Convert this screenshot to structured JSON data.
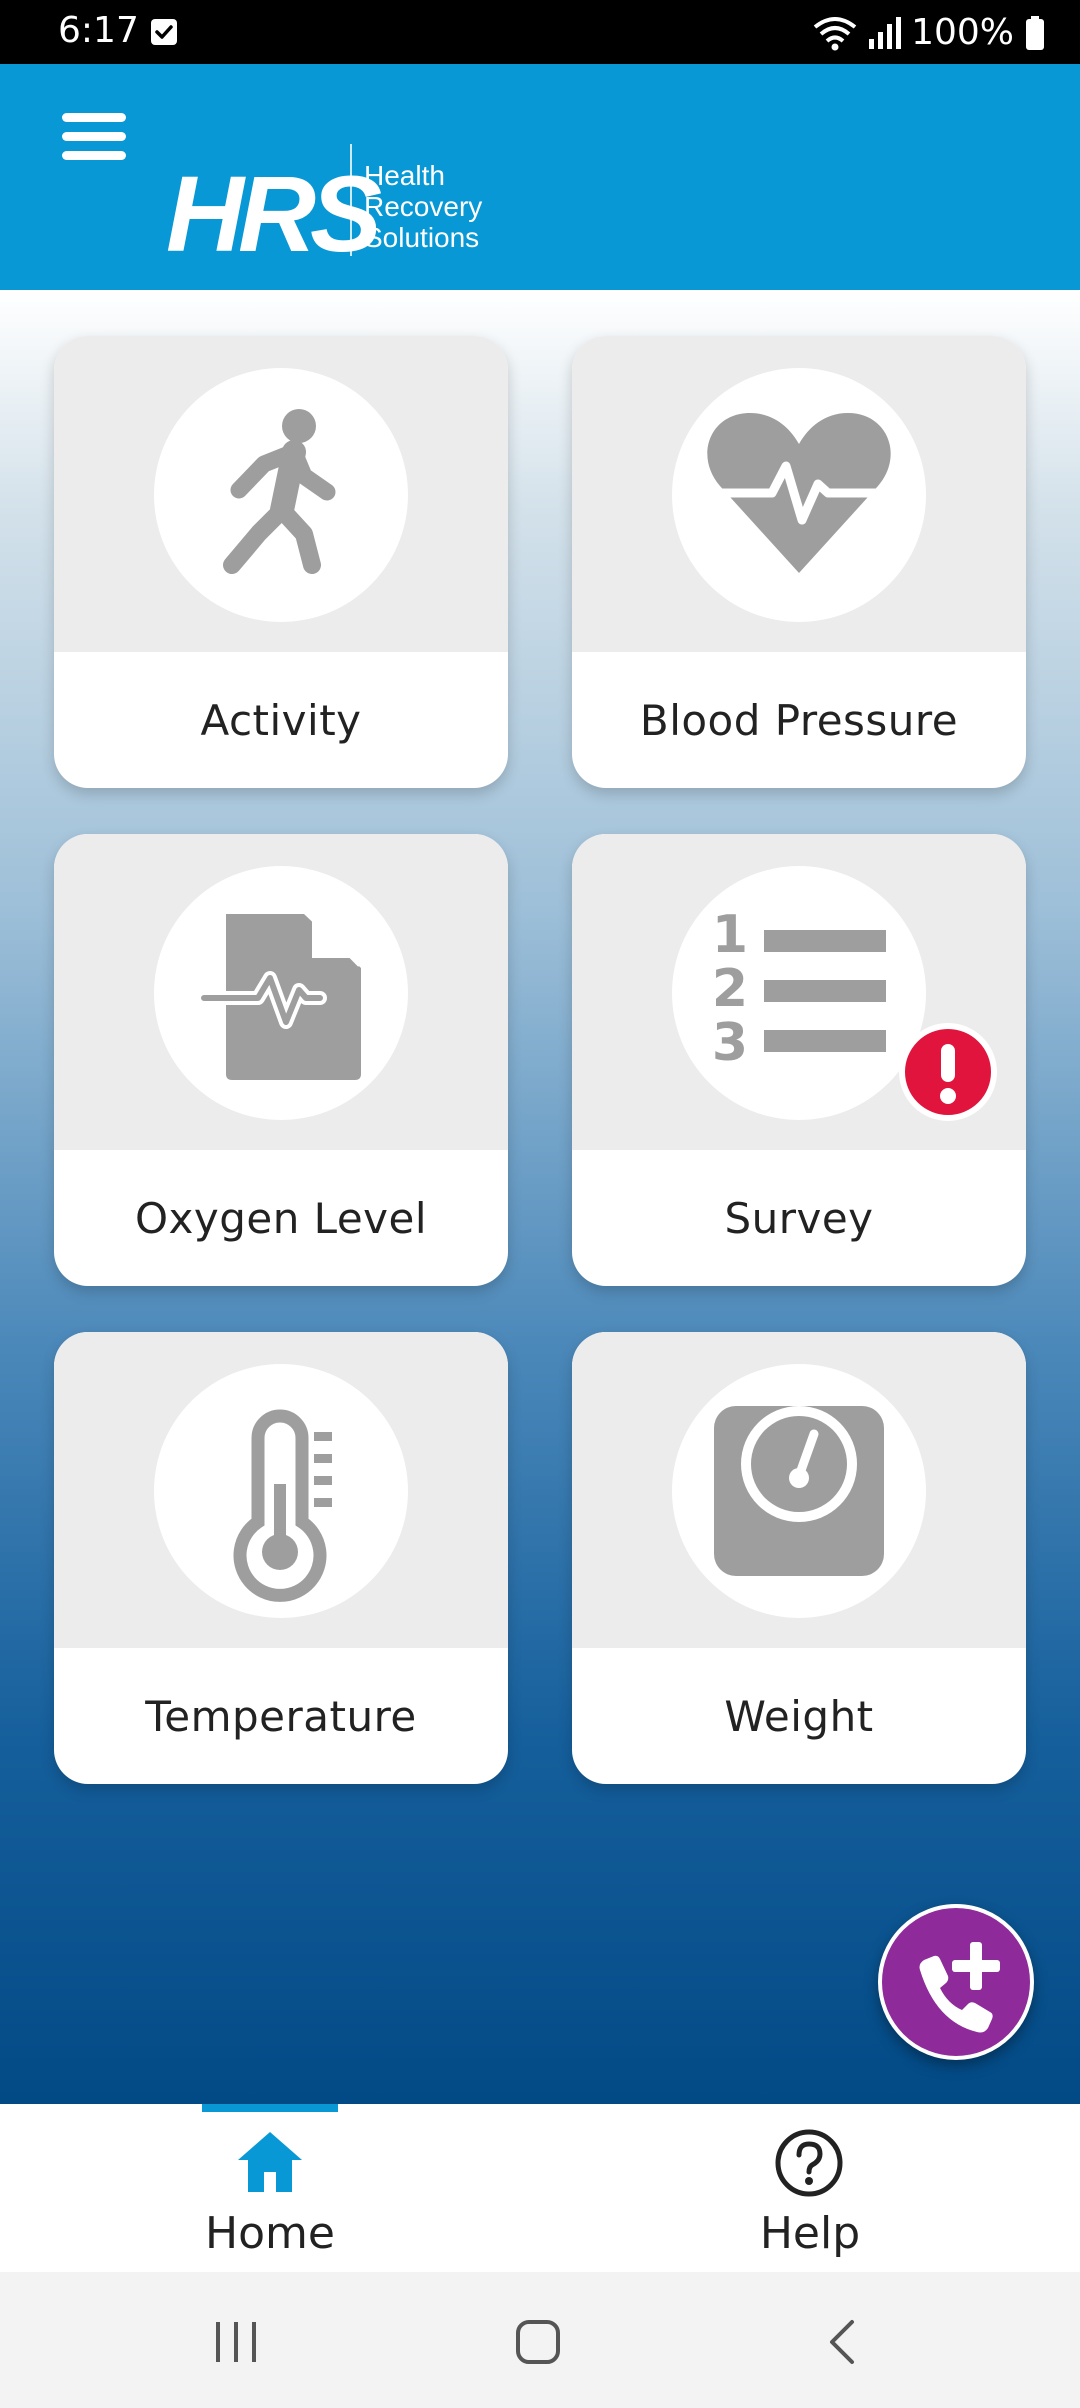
{
  "status_bar": {
    "time": "6:17",
    "battery": "100%",
    "icons": [
      "check-notification-icon",
      "wifi-icon",
      "signal-icon",
      "battery-icon"
    ]
  },
  "header": {
    "logo_text": "HRS",
    "logo_sub": [
      "Health",
      "Recovery",
      "Solutions"
    ],
    "background": "#0998d6"
  },
  "tiles": [
    {
      "label": "Activity",
      "icon": "walking-person-icon"
    },
    {
      "label": "Blood Pressure",
      "icon": "heart-pulse-icon"
    },
    {
      "label": "Oxygen Level",
      "icon": "document-pulse-icon"
    },
    {
      "label": "Survey",
      "icon": "numbered-list-icon",
      "alert": true
    },
    {
      "label": "Temperature",
      "icon": "thermometer-icon"
    },
    {
      "label": "Weight",
      "icon": "scale-icon"
    }
  ],
  "fab": {
    "icon": "phone-plus-icon",
    "color": "#8e2a9a"
  },
  "bottom_nav": [
    {
      "label": "Home",
      "icon": "home-icon",
      "active": true
    },
    {
      "label": "Help",
      "icon": "help-icon",
      "active": false
    }
  ],
  "colors": {
    "accent": "#0998d6",
    "alert": "#e0143c",
    "icon_gray": "#9e9e9e"
  }
}
